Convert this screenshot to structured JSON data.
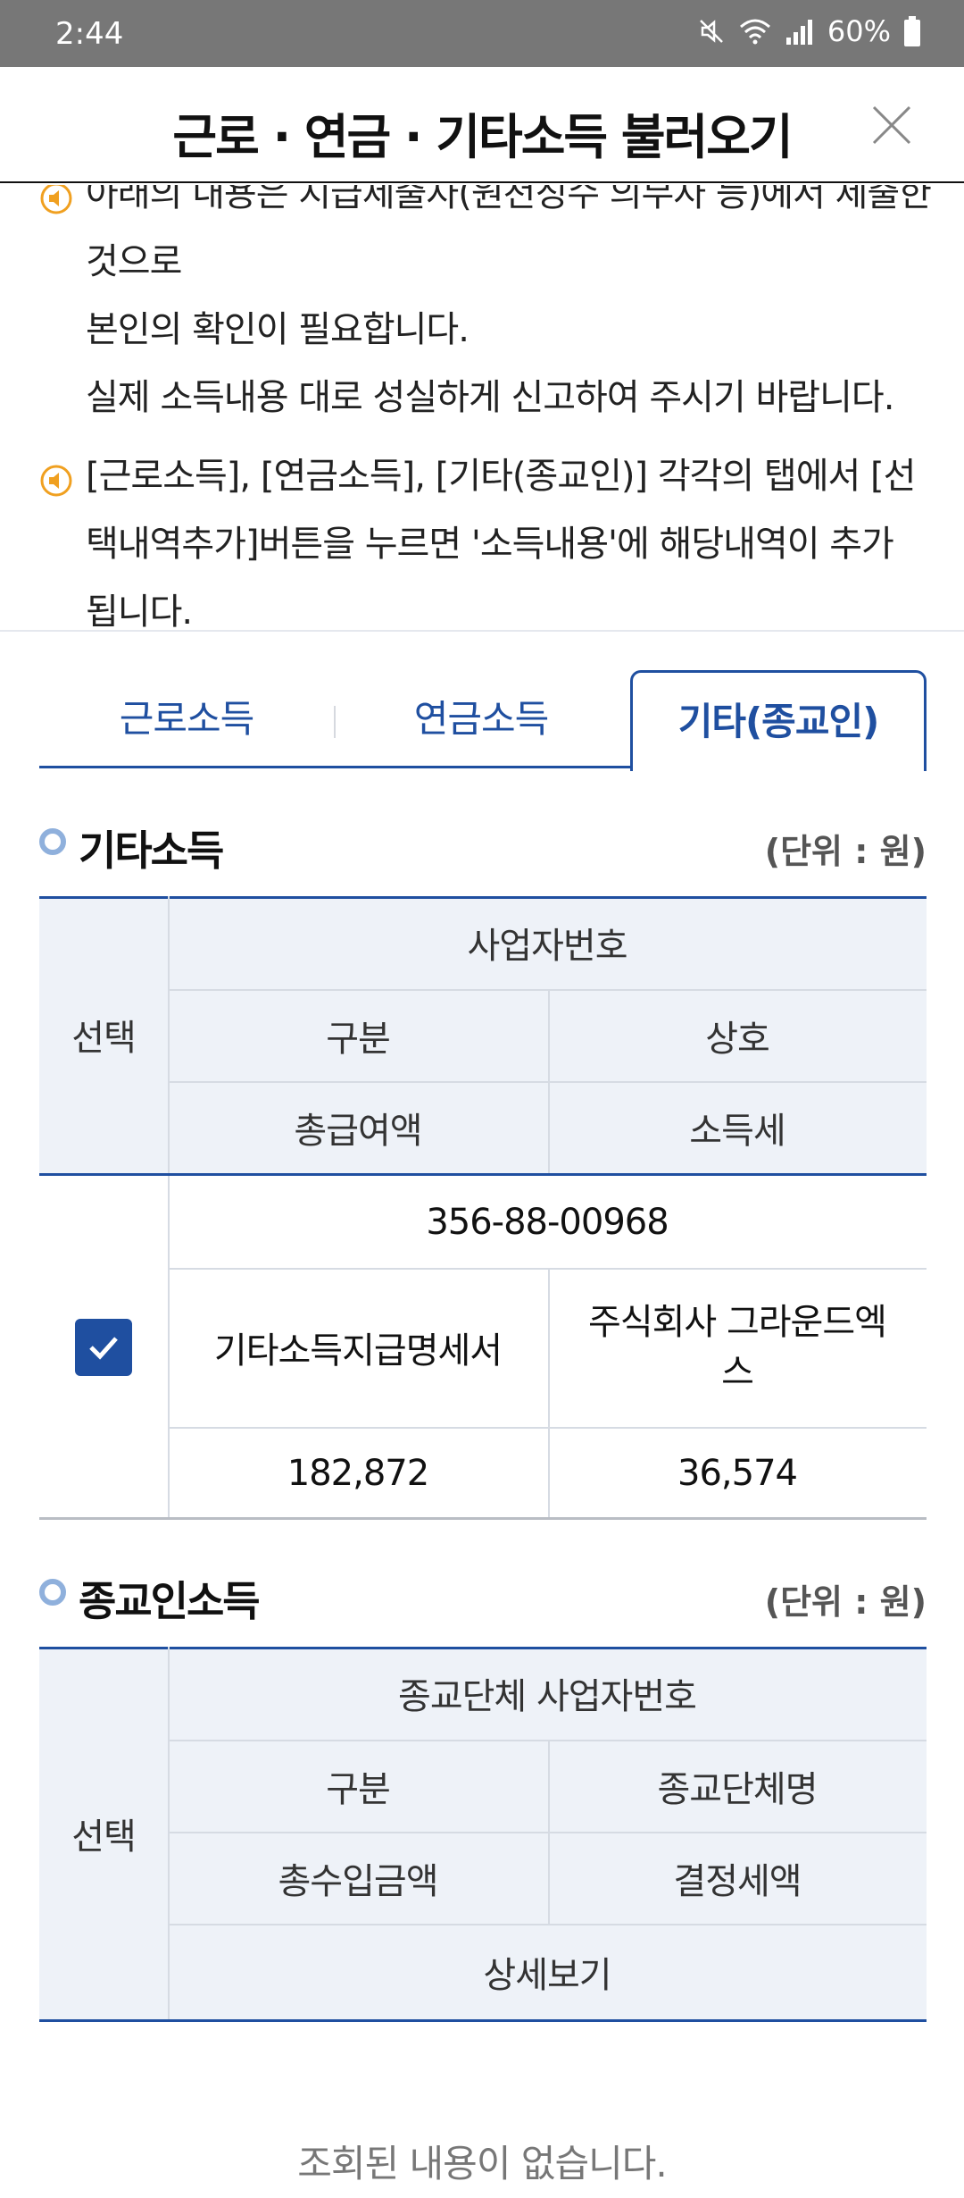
{
  "status_bar": {
    "time": "2:44",
    "battery": "60%"
  },
  "header": {
    "title": "근로 · 연금 · 기타소득 불러오기"
  },
  "notice": {
    "items": [
      {
        "line1": "아래의 내용은 지급제출자(원천징수 의무자 등)에서 제출한 것으로",
        "line2": "본인의 확인이 필요합니다.",
        "line3": "실제 소득내용 대로 성실하게 신고하여 주시기 바랍니다."
      },
      {
        "line1": "[근로소득], [연금소득], [기타(종교인)] 각각의 탭에서 [선",
        "line2": "택내역추가]버튼을 누르면 '소득내용'에 해당내역이 추가",
        "line3": "됩니다."
      }
    ]
  },
  "tabs": [
    {
      "label": "근로소득"
    },
    {
      "label": "연금소득"
    },
    {
      "label": "기타(종교인)",
      "active": true
    }
  ],
  "other_income": {
    "title": "기타소득",
    "unit": "(단위 : 원)",
    "headers": {
      "select": "선택",
      "business_no": "사업자번호",
      "category": "구분",
      "company": "상호",
      "total_pay": "총급여액",
      "income_tax": "소득세"
    },
    "rows": [
      {
        "checked": true,
        "business_no": "356-88-00968",
        "category": "기타소득지급명세서",
        "company_line1": "주식회사 그라운드엑",
        "company_line2": "스",
        "total_pay": "182,872",
        "income_tax": "36,574"
      }
    ]
  },
  "religious_income": {
    "title": "종교인소득",
    "unit": "(단위 : 원)",
    "headers": {
      "select": "선택",
      "business_no": "종교단체 사업자번호",
      "category": "구분",
      "org_name": "종교단체명",
      "total_income": "총수입금액",
      "decided_tax": "결정세액",
      "detail": "상세보기"
    },
    "empty_message": "조회된 내용이 없습니다."
  },
  "colors": {
    "accent": "#1f4fa0",
    "header_bg": "#eef2f8",
    "status_bar": "#777777",
    "notice_icon": "#f0a020"
  }
}
